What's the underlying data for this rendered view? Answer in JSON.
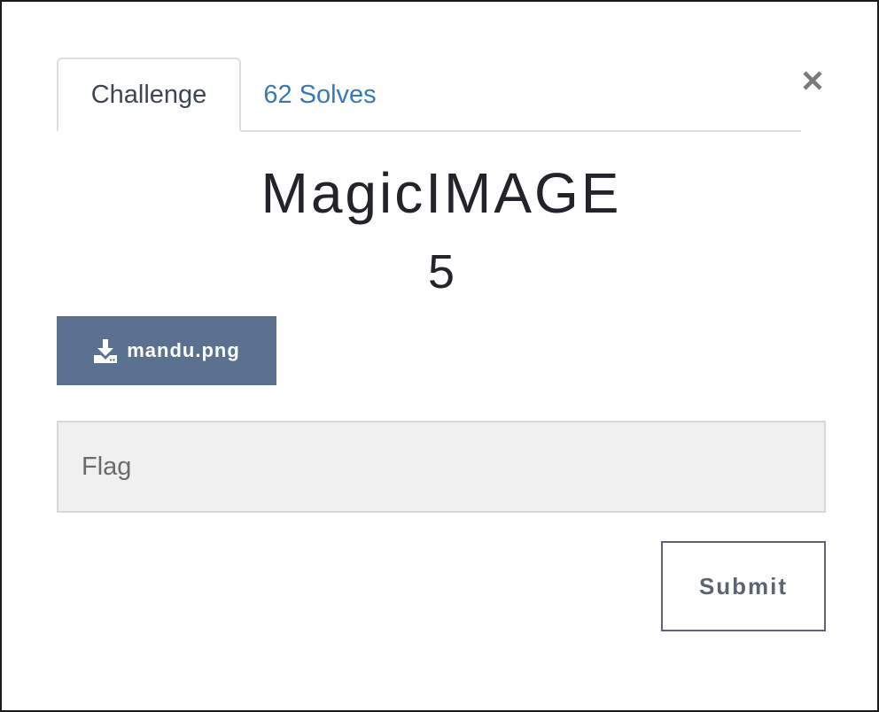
{
  "tabs": [
    {
      "label": "Challenge",
      "active": true
    },
    {
      "label": "62 Solves",
      "active": false
    }
  ],
  "challenge": {
    "name": "MagicIMAGE",
    "points": "5"
  },
  "file": {
    "icon": "download-icon",
    "label": "mandu.png"
  },
  "flag_input": {
    "placeholder": "Flag",
    "value": ""
  },
  "submit_label": "Submit",
  "close_icon": "close-icon",
  "colors": {
    "file_button_bg": "#5c7190",
    "link": "#3779b7",
    "input_bg": "#f0f0f0",
    "submit_border": "#5b6470"
  }
}
